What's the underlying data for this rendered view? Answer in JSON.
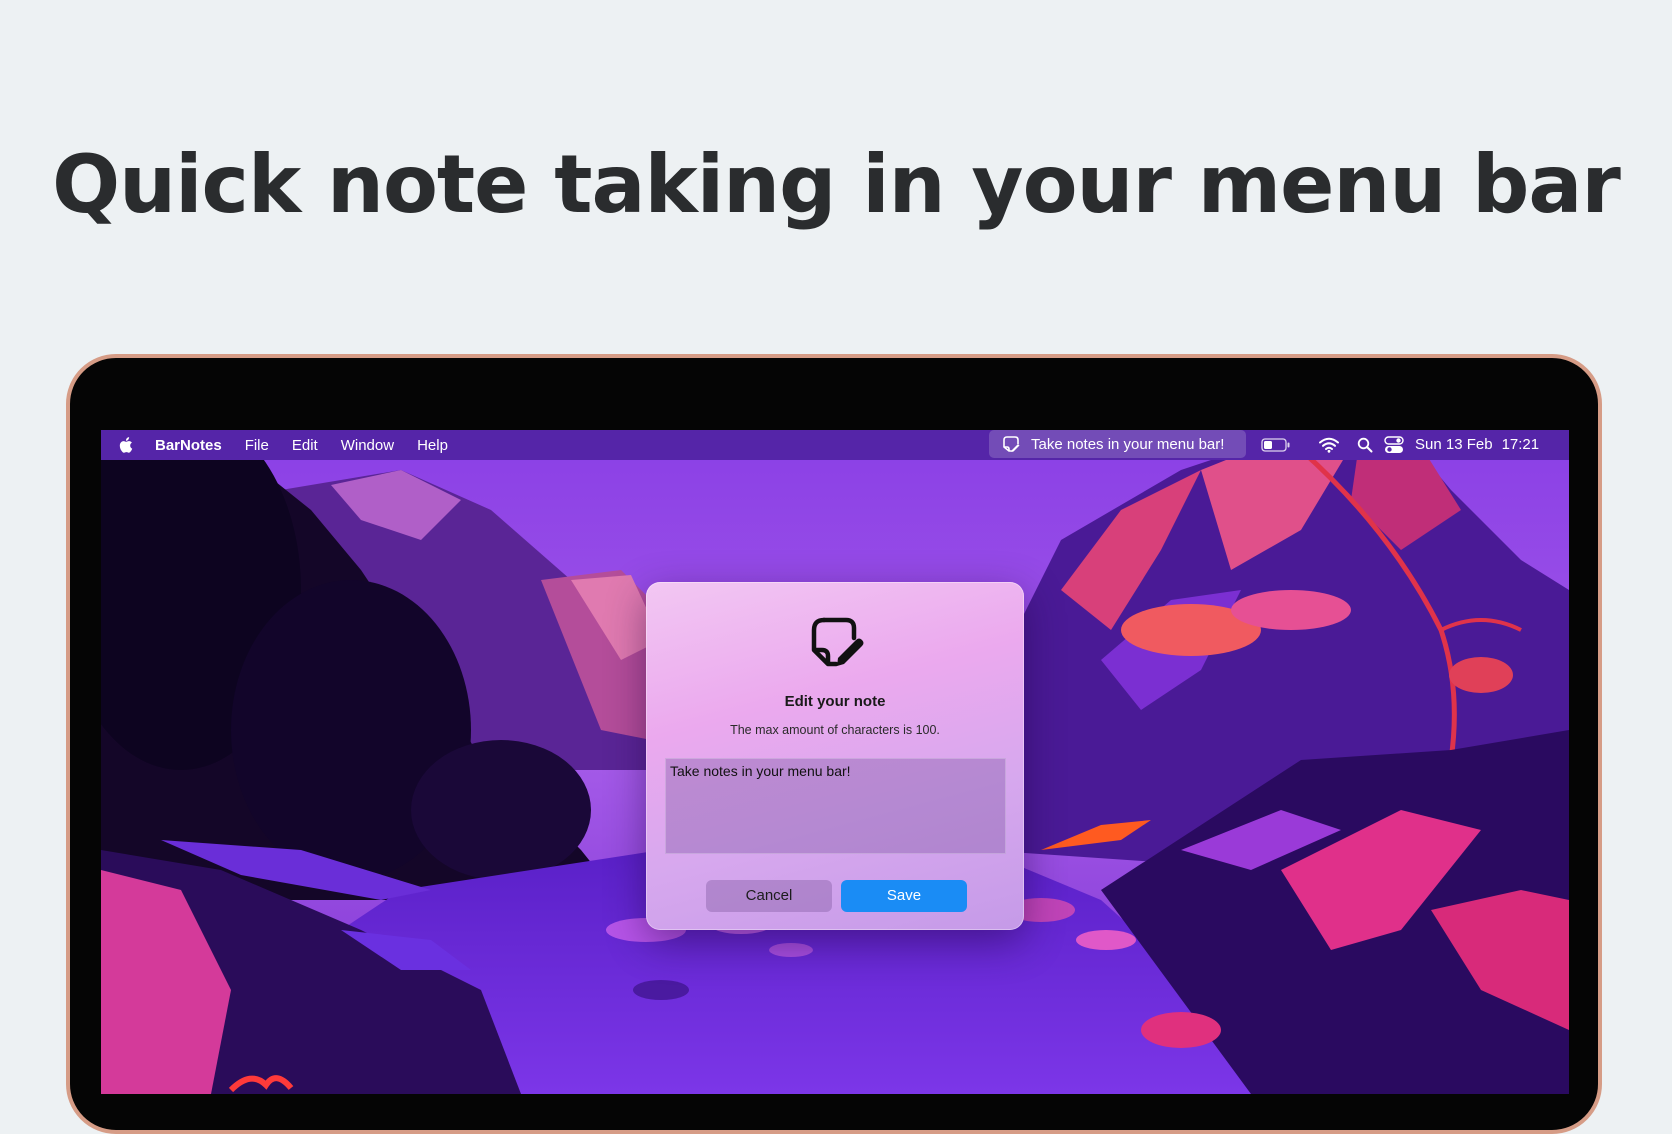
{
  "headline": "Quick note taking in your menu bar",
  "menubar": {
    "apple_icon": "apple-logo-icon",
    "app_name": "BarNotes",
    "menus": [
      "File",
      "Edit",
      "Window",
      "Help"
    ],
    "status_item": {
      "icon": "note-edit-icon",
      "text": "Take notes in your menu bar!"
    },
    "tray_icons": [
      "battery-icon",
      "wifi-icon",
      "search-icon",
      "control-center-icon"
    ],
    "clock": {
      "date": "Sun 13 Feb",
      "time": "17:21"
    }
  },
  "dialog": {
    "icon": "note-edit-icon",
    "title": "Edit your note",
    "subtitle": "The max amount of characters is 100.",
    "note_value": "Take notes in your menu bar!",
    "cancel_label": "Cancel",
    "save_label": "Save"
  },
  "colors": {
    "page_bg": "#edf1f3",
    "laptop_bezel": "#050505",
    "laptop_edge": "#d69c86",
    "menubar": "#5525a8",
    "accent": "#1a8cf5"
  }
}
